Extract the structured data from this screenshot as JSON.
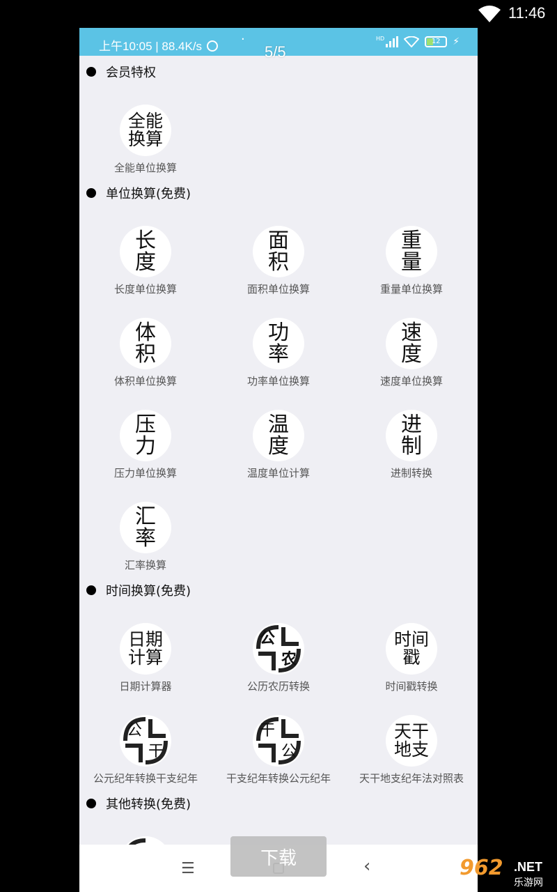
{
  "system_status": {
    "time": "11:46"
  },
  "inner_status": {
    "left_text": "上午10:05 | 88.4K/s",
    "hd": "HD",
    "battery": "12"
  },
  "page_indicator": "5/5",
  "sections": [
    {
      "heading": "会员特权",
      "items": [
        {
          "icon_text": "全能换算",
          "label": "全能单位换算"
        }
      ]
    },
    {
      "heading": "单位换算(免费)",
      "items": [
        {
          "icon_text": "长度",
          "label": "长度单位换算"
        },
        {
          "icon_text": "面积",
          "label": "面积单位换算"
        },
        {
          "icon_text": "重量",
          "label": "重量单位换算"
        },
        {
          "icon_text": "体积",
          "label": "体积单位换算"
        },
        {
          "icon_text": "功率",
          "label": "功率单位换算"
        },
        {
          "icon_text": "速度",
          "label": "速度单位换算"
        },
        {
          "icon_text": "压力",
          "label": "压力单位换算"
        },
        {
          "icon_text": "温度",
          "label": "温度单位计算"
        },
        {
          "icon_text": "进制",
          "label": "进制转换"
        },
        {
          "icon_text": "汇率",
          "label": "汇率换算"
        }
      ]
    },
    {
      "heading": "时间换算(免费)",
      "items": [
        {
          "icon_text": "日期计算",
          "label": "日期计算器"
        },
        {
          "icon_glyphs": [
            "公",
            "农"
          ],
          "label": "公历农历转换"
        },
        {
          "icon_text": "时间戳",
          "label": "时间戳转换"
        },
        {
          "icon_glyphs": [
            "公",
            "干"
          ],
          "label": "公元纪年转换干支纪年"
        },
        {
          "icon_glyphs": [
            "干",
            "公"
          ],
          "label": "干支纪年转换公元纪年"
        },
        {
          "icon_text": "天干地支",
          "label": "天干地支纪年法对照表"
        }
      ]
    },
    {
      "heading": "其他转换(免费)",
      "items": []
    }
  ],
  "download_button": "下载",
  "watermark": {
    "logo": "962",
    "net": ".NET",
    "sub": "乐游网"
  },
  "colors": {
    "status_bar": "#5bc3e5",
    "background": "#efeff4",
    "logo_orange": "#f29a2e"
  }
}
